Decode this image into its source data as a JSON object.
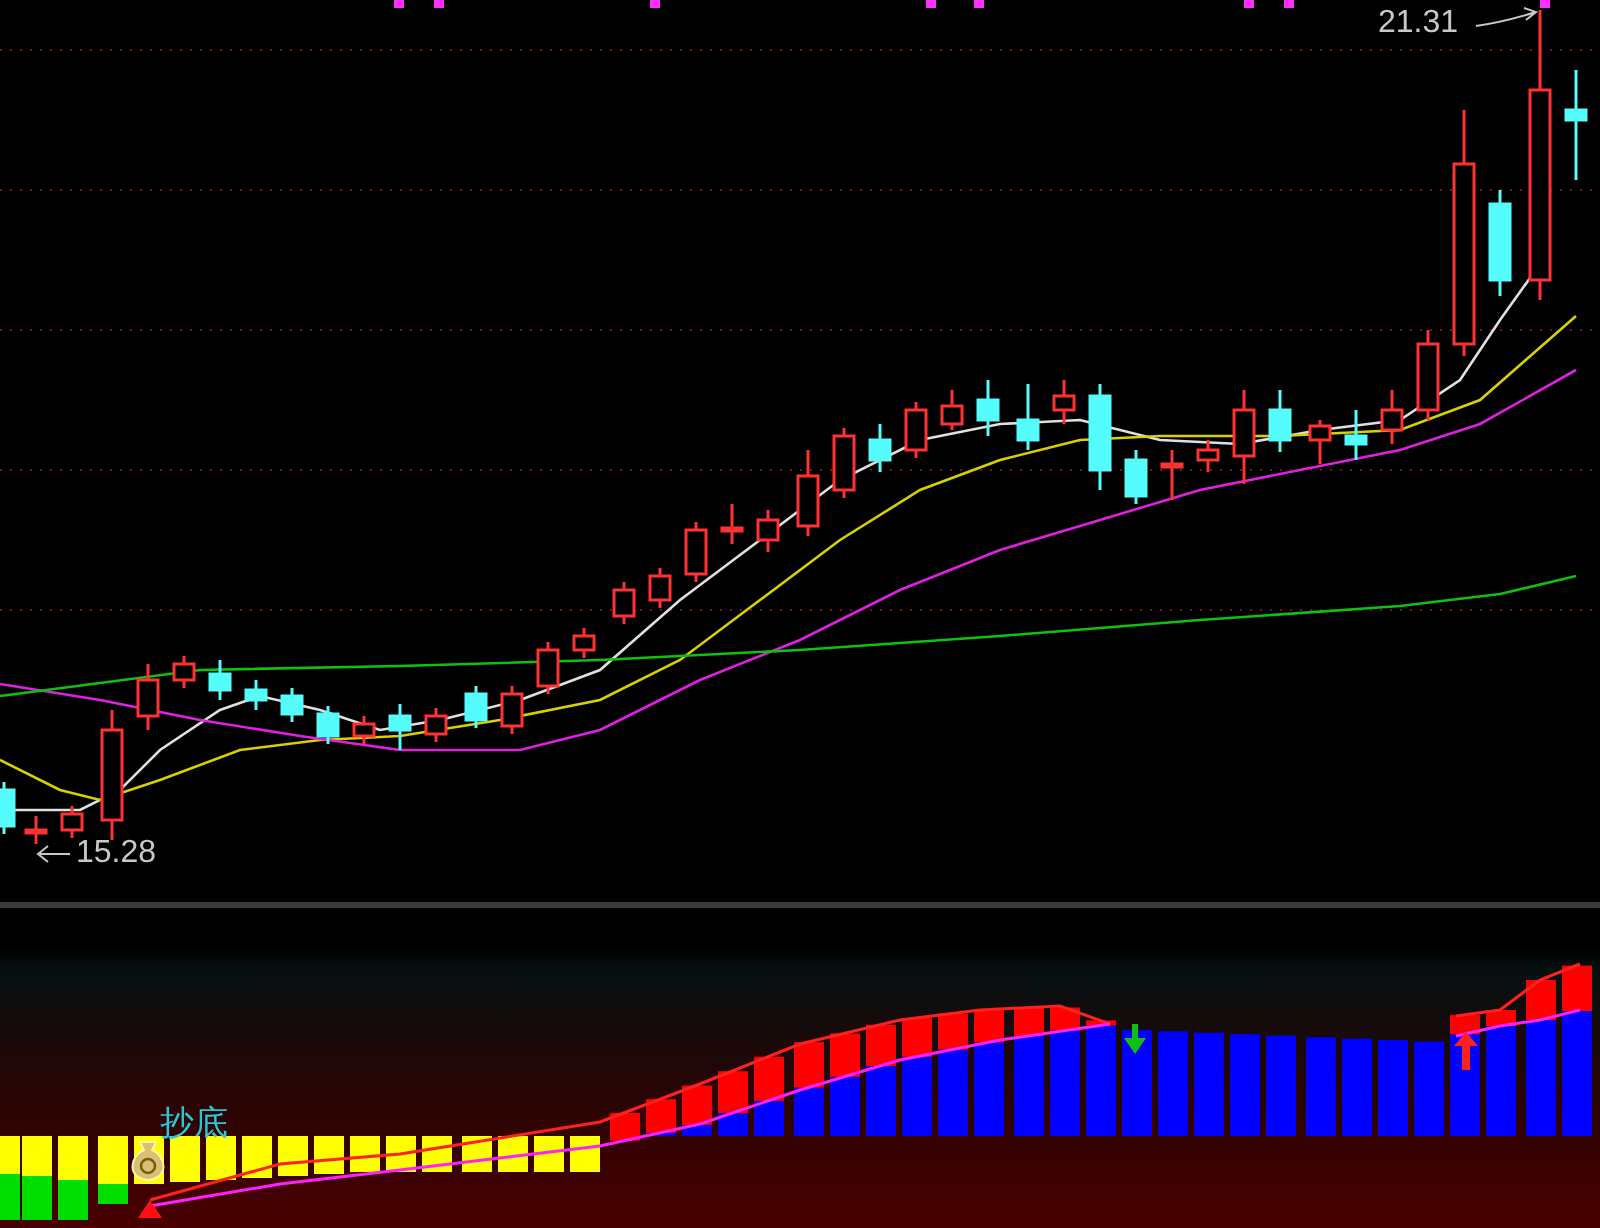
{
  "price_chart": {
    "high_label": "21.31",
    "low_label": "15.28"
  },
  "indicator": {
    "signal_label": "抄底"
  }
}
